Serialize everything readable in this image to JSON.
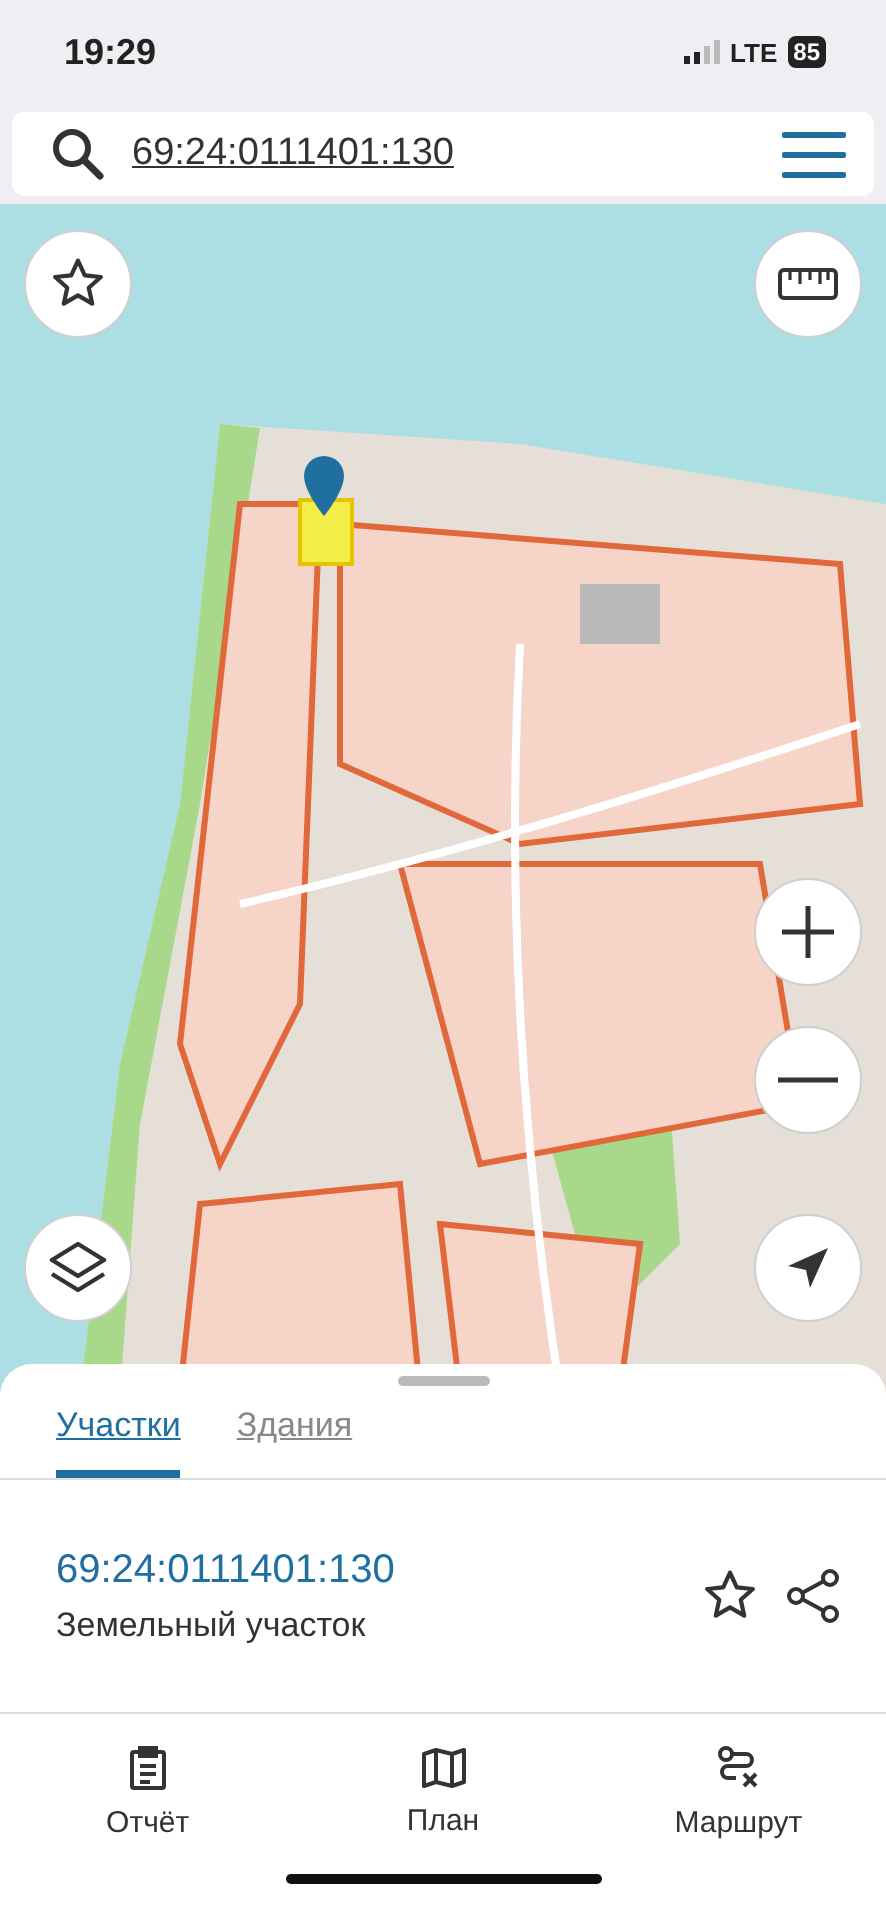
{
  "status_bar": {
    "time": "19:29",
    "network": "LTE",
    "battery": "85"
  },
  "search": {
    "value": "69:24:0111401:130"
  },
  "tabs": [
    {
      "label": "Участки",
      "selected": true
    },
    {
      "label": "Здания",
      "selected": false
    }
  ],
  "parcel": {
    "number": "69:24:0111401:130",
    "type": "Земельный участок"
  },
  "bottom_nav": [
    {
      "label": "Отчёт",
      "kind": "report"
    },
    {
      "label": "План",
      "kind": "map"
    },
    {
      "label": "Маршрут",
      "kind": "route"
    }
  ]
}
